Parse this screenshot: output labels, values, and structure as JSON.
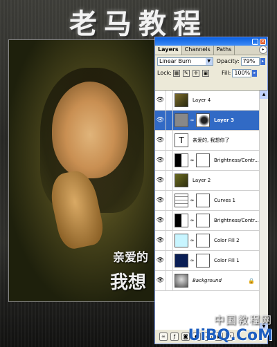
{
  "banner": {
    "title": "老马教程"
  },
  "artwork": {
    "caption_line1": "亲爱的",
    "caption_line2": "我想"
  },
  "panel": {
    "tabs": [
      "Layers",
      "Channels",
      "Paths"
    ],
    "blend_mode": "Linear Burn",
    "opacity_label": "Opacity:",
    "opacity_value": "79%",
    "lock_label": "Lock:",
    "fill_label": "Fill:",
    "fill_value": "100%",
    "layers": [
      {
        "name": "Layer 4",
        "selected": false
      },
      {
        "name": "Layer 3",
        "selected": true
      },
      {
        "name": "亲爱的, 我想你了",
        "selected": false
      },
      {
        "name": "Brightness/Contr...",
        "selected": false
      },
      {
        "name": "Layer 2",
        "selected": false
      },
      {
        "name": "Curves 1",
        "selected": false
      },
      {
        "name": "Brightness/Contr...",
        "selected": false
      },
      {
        "name": "Color Fill 2",
        "selected": false
      },
      {
        "name": "Color Fill 1",
        "selected": false
      },
      {
        "name": "Background",
        "selected": false
      }
    ],
    "text_layer_glyph": "T"
  },
  "watermark": {
    "line1": "中国教程网",
    "line2": "UiBQ.CoM"
  },
  "colors": {
    "selected_layer": "#316ac5",
    "color_fill_2": "#c8f5ff",
    "color_fill_1": "#0a1e55",
    "titlebar": "#0a5fe0"
  }
}
